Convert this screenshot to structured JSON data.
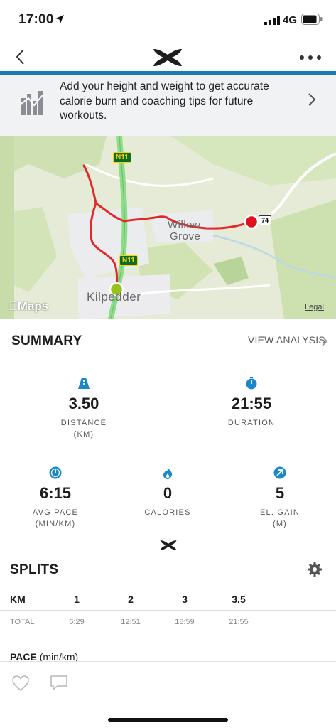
{
  "status_bar": {
    "time": "17:00",
    "network": "4G"
  },
  "banner": {
    "text": "Add your height and weight to get accurate calorie burn and coaching tips for future workouts."
  },
  "map": {
    "labels": {
      "town1": "Willow",
      "town2": "Grove",
      "town3": "Kilpedder"
    },
    "road_badges": {
      "n11_top": "N11",
      "n11_bottom": "N11",
      "route74": "74"
    },
    "credit": "Maps",
    "legal": "Legal",
    "route_color": "#e02a2a",
    "start_color": "#97c21e",
    "end_color": "#e0101e"
  },
  "summary": {
    "title": "SUMMARY",
    "view_analysis": "VIEW ANALYSIS",
    "distance": {
      "value": "3.50",
      "label": "DISTANCE",
      "unit": "(KM)"
    },
    "duration": {
      "value": "21:55",
      "label": "DURATION"
    },
    "avg_pace": {
      "value": "6:15",
      "label": "AVG PACE",
      "unit": "(MIN/KM)"
    },
    "calories": {
      "value": "0",
      "label": "CALORIES"
    },
    "el_gain": {
      "value": "5",
      "label": "EL. GAIN",
      "unit": "(M)"
    },
    "accent_color": "#1a88c9"
  },
  "splits": {
    "title": "SPLITS",
    "km_header": "KM",
    "km": [
      "1",
      "2",
      "3",
      "3.5"
    ],
    "total_label": "TOTAL",
    "totals": [
      "6:29",
      "12:51",
      "18:59",
      "21:55"
    ],
    "pace_title": "PACE",
    "pace_unit": "(min/km)"
  }
}
